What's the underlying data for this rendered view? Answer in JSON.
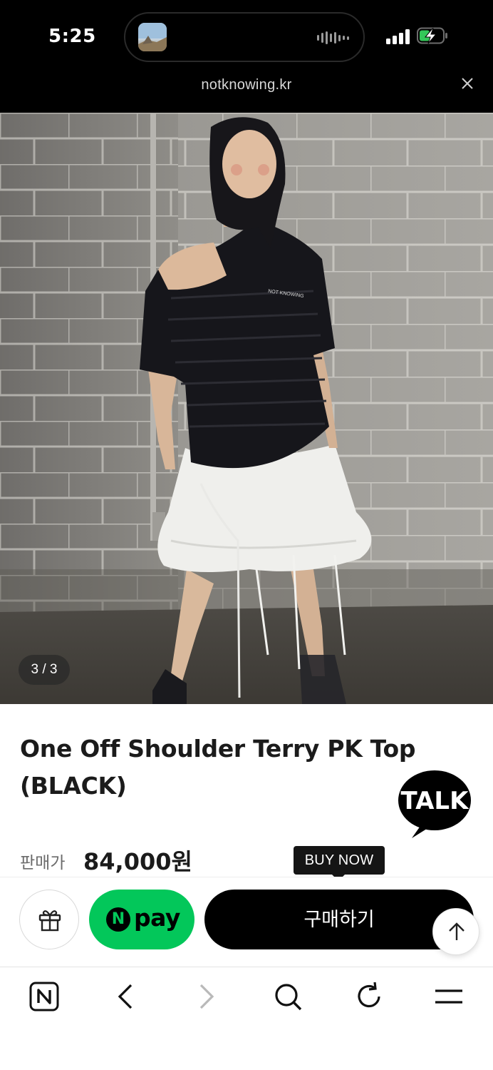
{
  "status_bar": {
    "time": "5:25",
    "battery_state": "charging",
    "activity_icon": "audio-wave-icon"
  },
  "browser": {
    "url": "notknowing.kr",
    "close_icon": "close-icon"
  },
  "gallery": {
    "counter": "3 / 3",
    "current_index": 3,
    "total": 3
  },
  "product": {
    "title": "One Off Shoulder Terry PK Top (BLACK)",
    "price_label": "판매가",
    "price": "84,000원"
  },
  "chat": {
    "label": "TALK"
  },
  "purchase": {
    "tooltip": "BUY NOW",
    "gift_icon": "gift-icon",
    "npay_letter": "N",
    "npay_label": "pay",
    "buy_label": "구매하기",
    "scroll_top_icon": "arrow-up-icon"
  },
  "toolbar": {
    "items": [
      "naver-home-icon",
      "back-icon",
      "forward-icon",
      "search-icon",
      "refresh-icon",
      "menu-icon"
    ],
    "forward_enabled": false
  },
  "colors": {
    "status_bg": "#000000",
    "npay_green": "#03c75a",
    "buy_black": "#000000",
    "text_dark": "#1b1b1b",
    "text_muted": "#6b6b6b"
  }
}
